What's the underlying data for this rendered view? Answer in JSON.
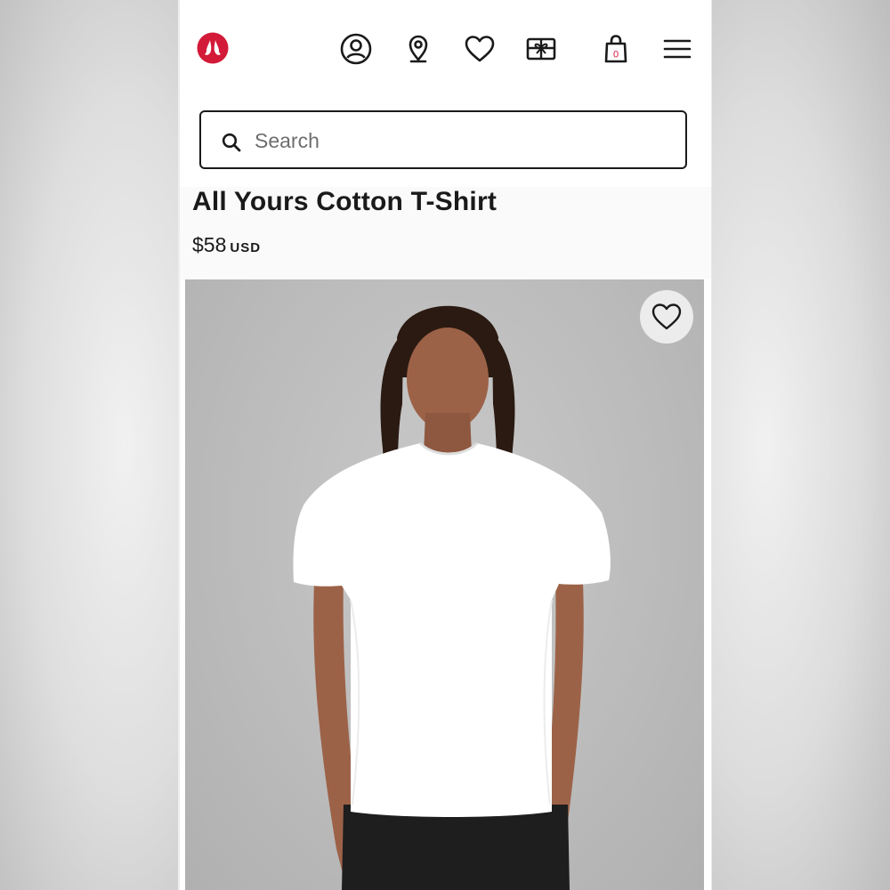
{
  "header": {
    "brand_logo": "lululemon-logo",
    "icons": [
      "account-icon",
      "store-locator-icon",
      "wishlist-heart-icon",
      "gift-card-icon",
      "shopping-bag-icon",
      "menu-icon"
    ],
    "bag_count": "0",
    "brand_color": "#d31a38"
  },
  "search": {
    "placeholder": "Search",
    "value": ""
  },
  "product": {
    "title": "All Yours Cotton T-Shirt",
    "price": "$58",
    "currency": "USD"
  },
  "image": {
    "description_icon": "wishlist-heart-icon",
    "shirt_color": "#ffffff",
    "background_color": "#bdbdbd"
  }
}
